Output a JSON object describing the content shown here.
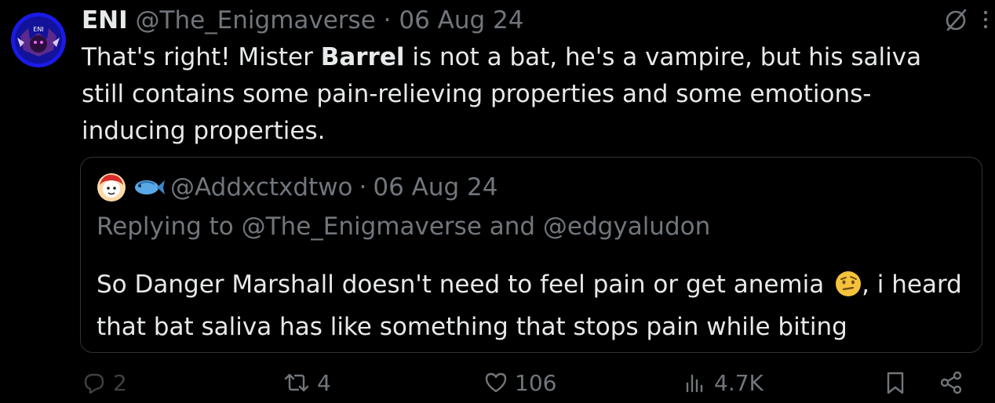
{
  "tweet": {
    "author": {
      "name": "ENI",
      "handle": "@The_Enigmaverse",
      "avatar_label": "ENI",
      "avatar_icon": "bat-character-avatar"
    },
    "separator": "·",
    "date": "06 Aug 24",
    "text_before_bold": "That's right! Mister ",
    "text_bold": "Barrel",
    "text_after_bold": " is not a bat, he's a vampire, but his saliva still contains some pain-relieving properties and some emotions-inducing properties."
  },
  "top_icons": [
    "grok-slash-icon",
    "more-dots-icon"
  ],
  "quote": {
    "avatar_icon": "pink-character-avatar",
    "name_emoji": "fish-emoji",
    "handle": "@Addxctxdtwo",
    "separator": "·",
    "date": "06 Aug 24",
    "reply_prefix": "Replying to ",
    "reply_user1": "@The_Enigmaverse",
    "reply_and": " and ",
    "reply_user2": "@edgyaludon",
    "text_before_emoji": "So Danger Marshall doesn't need to feel pain or get anemia ",
    "text_emoji": "face-with-raised-eyebrow-emoji",
    "text_after_emoji": ", i heard that bat saliva has like something that stops pain while biting"
  },
  "actions": {
    "replies": "2",
    "reposts": "4",
    "likes": "106",
    "views": "4.7K"
  },
  "colors": {
    "background": "#000000",
    "text": "#e7e9ea",
    "muted": "#71767b",
    "border": "#2f3336",
    "avatar_bg": "#1a1ae6"
  }
}
